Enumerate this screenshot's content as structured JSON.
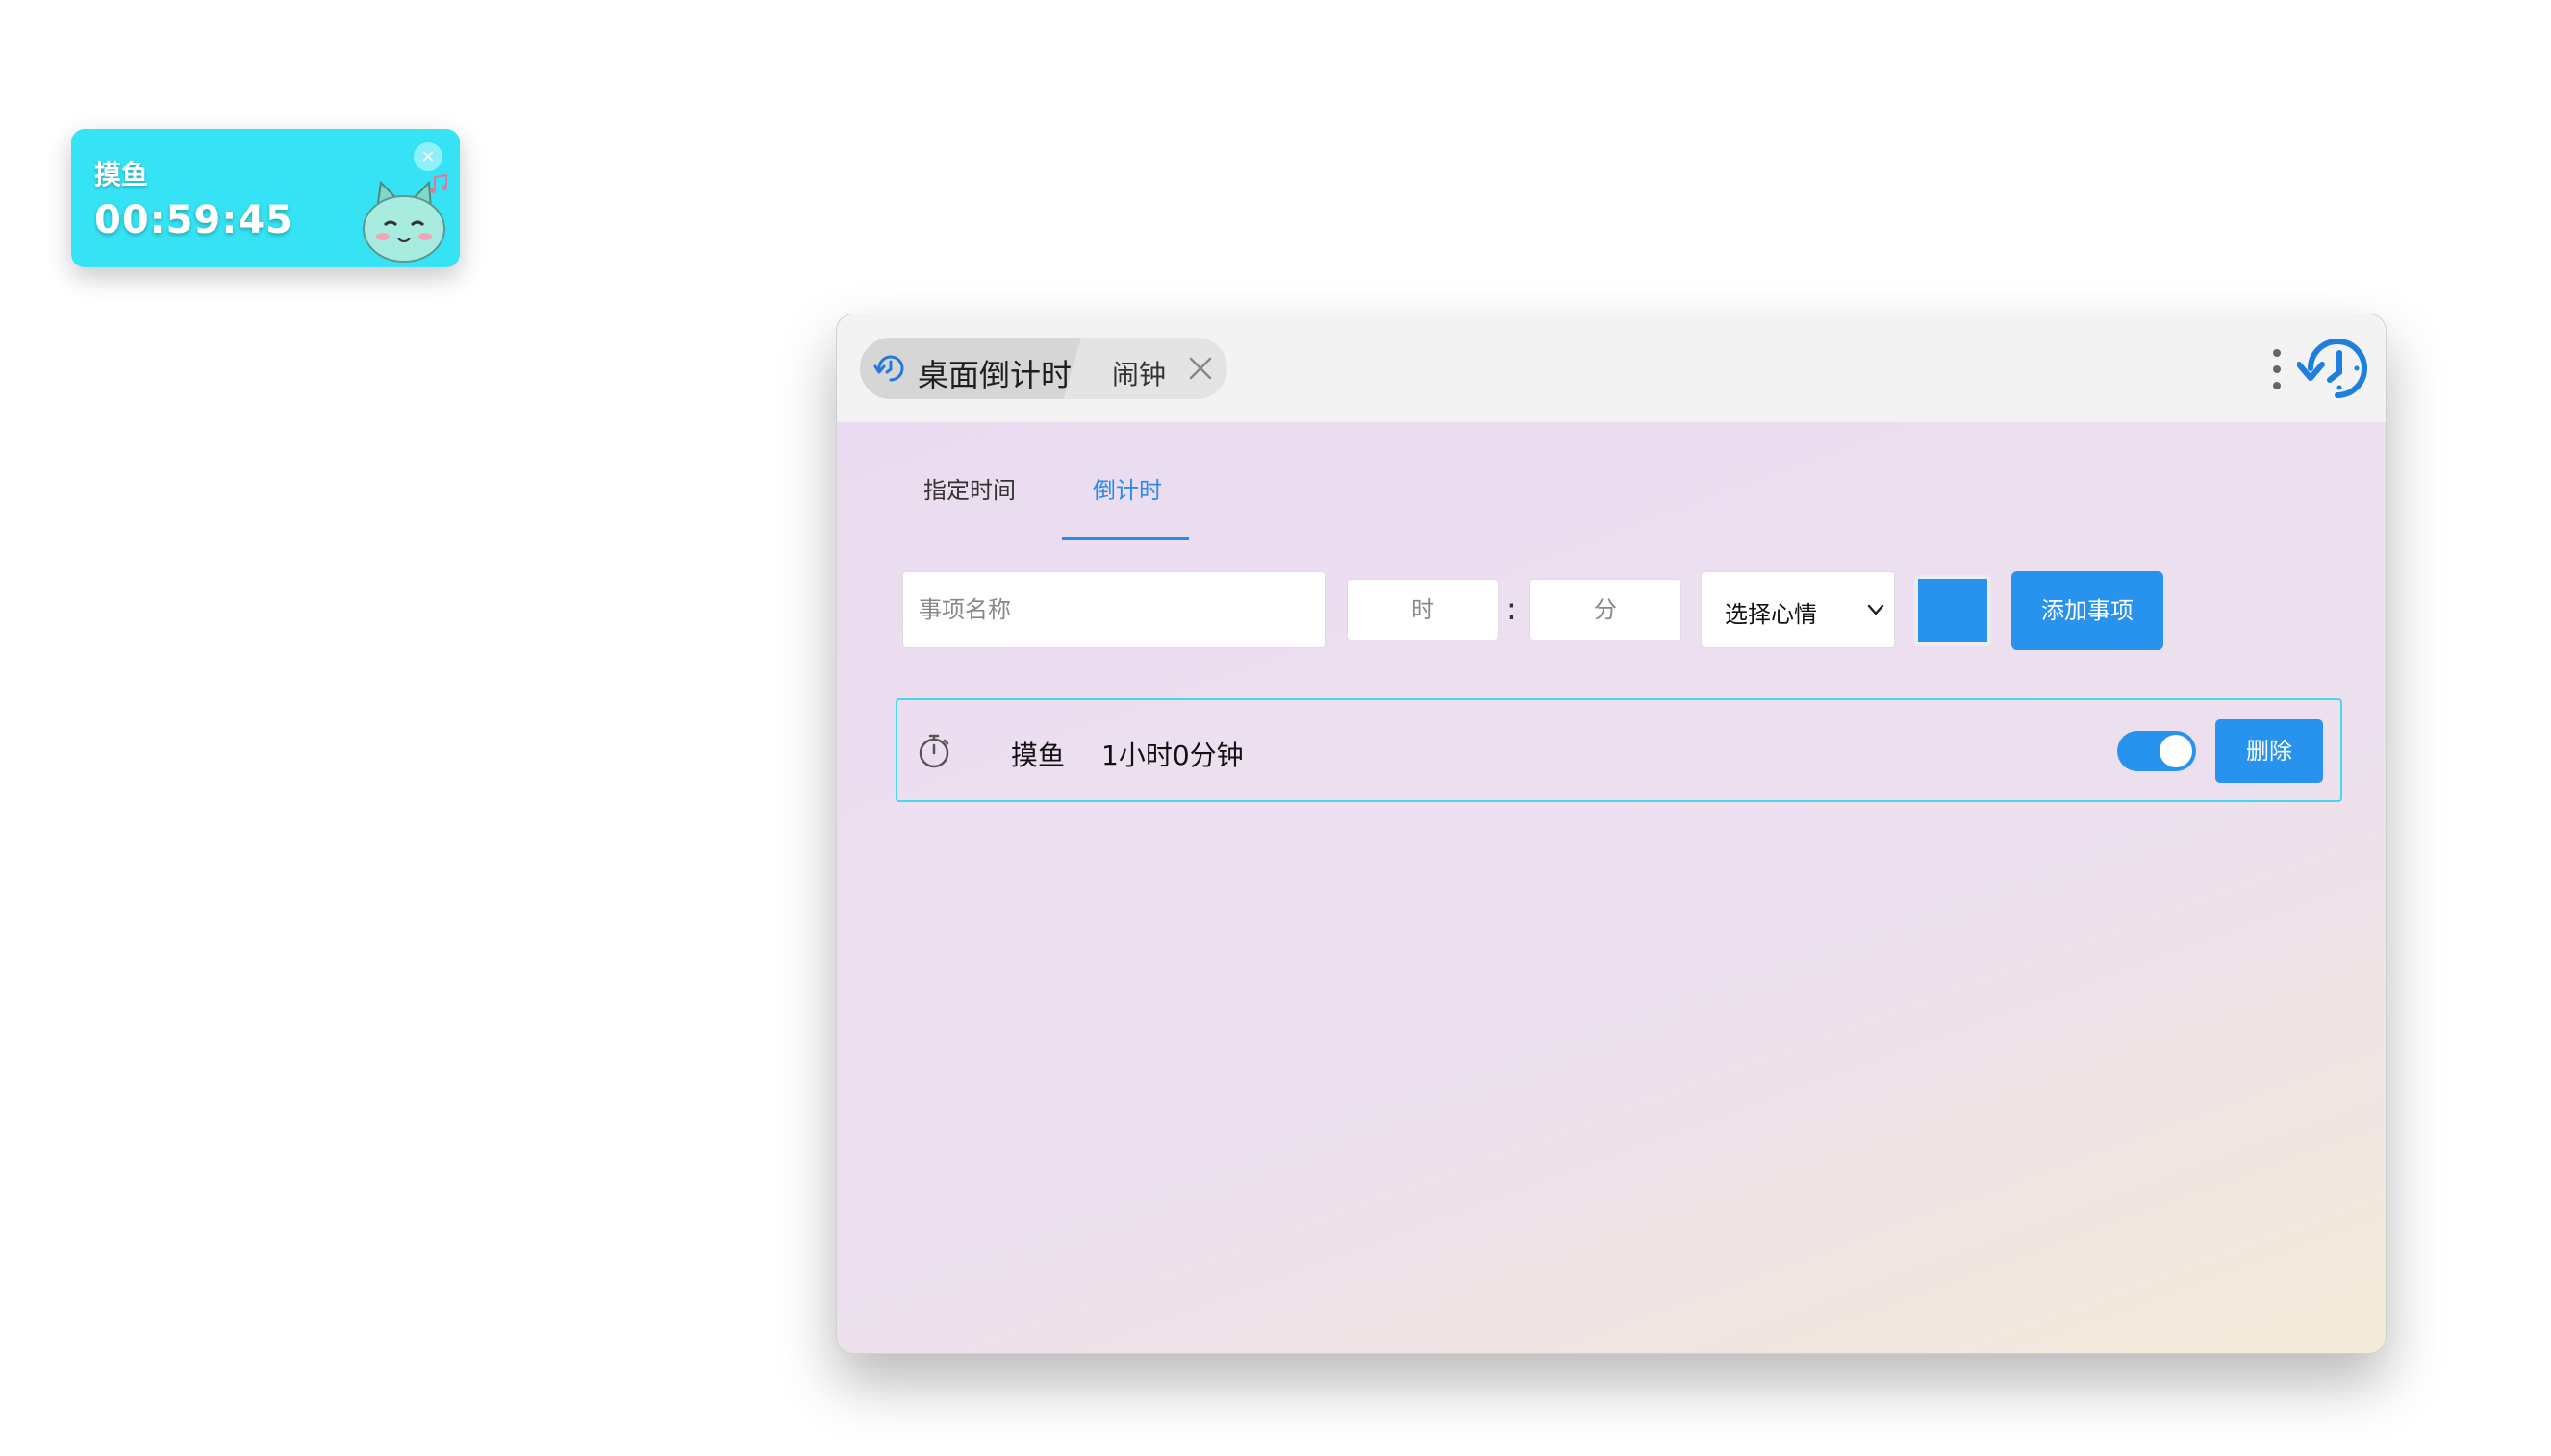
{
  "widget": {
    "title": "摸鱼",
    "time": "00:59:45",
    "close_label": "×",
    "mascot_icon": "cat-mascot-icon",
    "background": "#36e3f4"
  },
  "window": {
    "tabs": [
      {
        "label": "桌面倒计时",
        "icon": "clock-refresh-icon",
        "active": true
      },
      {
        "label": "闹钟",
        "active": false
      }
    ],
    "menu_icon": "vertical-dots-icon",
    "logo_icon": "clock-refresh-icon"
  },
  "mode_tabs": [
    {
      "label": "指定时间",
      "active": false
    },
    {
      "label": "倒计时",
      "active": true
    }
  ],
  "form": {
    "name_placeholder": "事项名称",
    "hour_placeholder": "时",
    "minute_placeholder": "分",
    "separator": ":",
    "mood_select": "选择心情",
    "color_value": "#2893ee",
    "add_label": "添加事项"
  },
  "items": [
    {
      "icon": "stopwatch-icon",
      "name": "摸鱼",
      "duration": "1小时0分钟",
      "enabled": true,
      "delete_label": "删除"
    }
  ],
  "colors": {
    "accent": "#2893ee",
    "item_border": "#48d8ec"
  }
}
